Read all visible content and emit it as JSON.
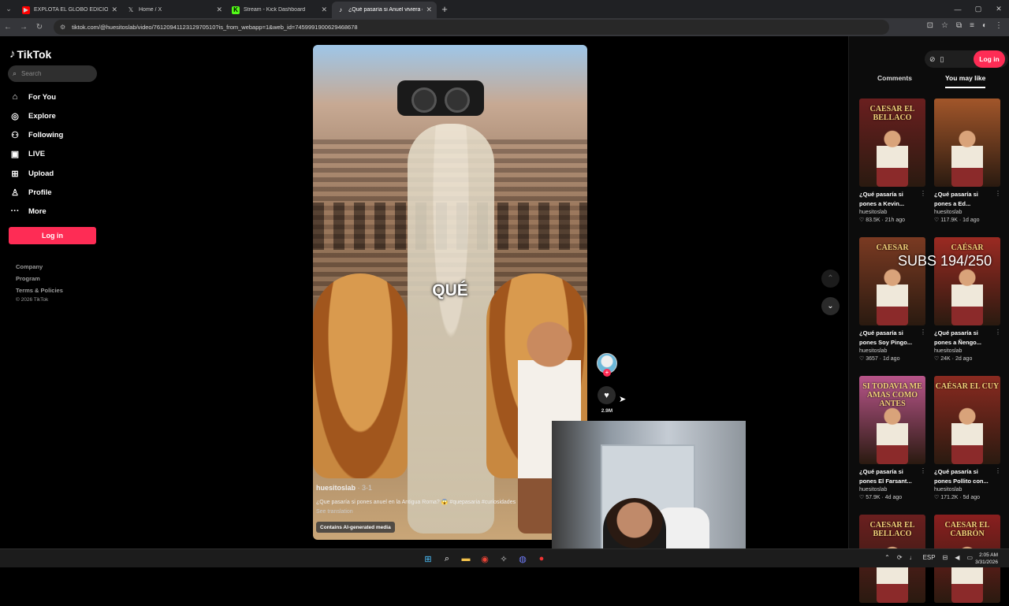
{
  "browser": {
    "tabs": [
      {
        "title": "EXPLOTA EL GLOBO EDICION E",
        "favicon": "youtube-icon",
        "color": "#ff0000"
      },
      {
        "title": "Home / X",
        "favicon": "x-icon",
        "color": "#ffffff"
      },
      {
        "title": "Stream - Kick Dashboard",
        "favicon": "kick-icon",
        "color": "#53fc18"
      },
      {
        "title": "¿Qué pasaría si Anuel viviera e",
        "favicon": "tiktok-icon",
        "color": "#ffffff"
      }
    ],
    "url": "tiktok.com/@huesitoslab/video/7612094112312970510?is_from_webapp=1&web_id=7459991900629468678"
  },
  "sidebar": {
    "logo": "TikTok",
    "search_placeholder": "Search",
    "nav": [
      {
        "label": "For You",
        "icon": "home-icon"
      },
      {
        "label": "Explore",
        "icon": "compass-icon"
      },
      {
        "label": "Following",
        "icon": "following-icon"
      },
      {
        "label": "LIVE",
        "icon": "live-icon"
      },
      {
        "label": "Upload",
        "icon": "upload-icon"
      },
      {
        "label": "Profile",
        "icon": "profile-icon"
      },
      {
        "label": "More",
        "icon": "more-icon"
      }
    ],
    "login": "Log in",
    "footer_links": [
      "Company",
      "Program",
      "Terms & Policies"
    ],
    "copyright": "© 2026 TikTok"
  },
  "video": {
    "caption_word": "QUÉ",
    "author": "huesitoslab",
    "date": "· 3-1",
    "description": "¿Que pasaría si pones anuel en la Antigua Roma? 😱 #quepasaria #curiosidades",
    "see_translation": "See translation",
    "ai_label": "Contains AI-generated media",
    "likes": "2.9M"
  },
  "right_panel": {
    "login": "Log in",
    "tabs": [
      "Comments",
      "You may like"
    ],
    "cards": [
      {
        "title": "¿Qué pasaría si pones a Kevin...",
        "author": "huesitoslab",
        "likes": "83.5K",
        "age": "21h ago",
        "thumb_text": "CAESAR EL BELLACO",
        "bg": "#6a1f1f"
      },
      {
        "title": "¿Qué pasaría si pones a Ed...",
        "author": "huesitoslab",
        "likes": "117.9K",
        "age": "1d ago",
        "thumb_text": "",
        "bg": "#a2562a"
      },
      {
        "title": "¿Qué pasaría si pones Soy Pingo...",
        "author": "huesitoslab",
        "likes": "3657",
        "age": "1d ago",
        "thumb_text": "CAESAR",
        "bg": "#7a3a22"
      },
      {
        "title": "¿Qué pasaría si pones a Ñengo...",
        "author": "huesitoslab",
        "likes": "24K",
        "age": "2d ago",
        "thumb_text": "CAÉSAR",
        "bg": "#9b2a22"
      },
      {
        "title": "¿Qué pasaría si pones El Farsant...",
        "author": "huesitoslab",
        "likes": "57.9K",
        "age": "4d ago",
        "thumb_text": "SI TODAVIA ME AMAS COMO ANTES",
        "bg": "#b8558a"
      },
      {
        "title": "¿Qué pasaría si pones Pollito con...",
        "author": "huesitoslab",
        "likes": "171.2K",
        "age": "5d ago",
        "thumb_text": "CAÉSAR EL CUY",
        "bg": "#8a2a20"
      },
      {
        "title": "",
        "author": "",
        "likes": "",
        "age": "",
        "thumb_text": "CAESAR EL BELLACO",
        "bg": "#6a1f1f"
      },
      {
        "title": "",
        "author": "",
        "likes": "",
        "age": "",
        "thumb_text": "CAESAR EL CABRÓN",
        "bg": "#8a1f1f"
      }
    ]
  },
  "overlay": {
    "subs": "SUBS 194/250"
  },
  "taskbar": {
    "lang": "ESP",
    "time": "2:05 AM",
    "date": "3/31/2026"
  }
}
